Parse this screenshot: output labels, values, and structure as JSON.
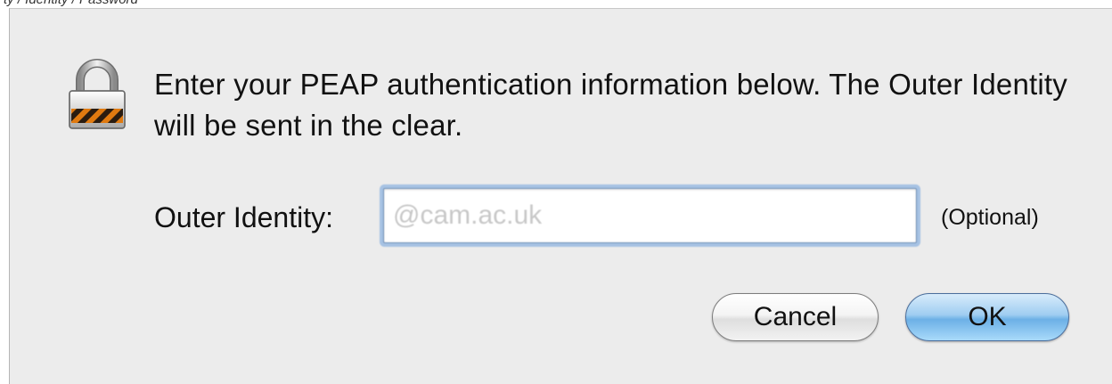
{
  "top_strip_text": "ty / Identity / Password",
  "dialog": {
    "message": "Enter your PEAP authentication information below. The Outer Identity will be sent in the clear.",
    "lock_icon": "lock-icon",
    "outer_identity": {
      "label": "Outer Identity:",
      "value": "@cam.ac.uk",
      "hint": "(Optional)"
    },
    "buttons": {
      "cancel_label": "Cancel",
      "ok_label": "OK"
    }
  },
  "colors": {
    "dialog_bg": "#ececec",
    "focus_ring": "#6ea0dc",
    "ok_button": "#6cb0e6"
  }
}
